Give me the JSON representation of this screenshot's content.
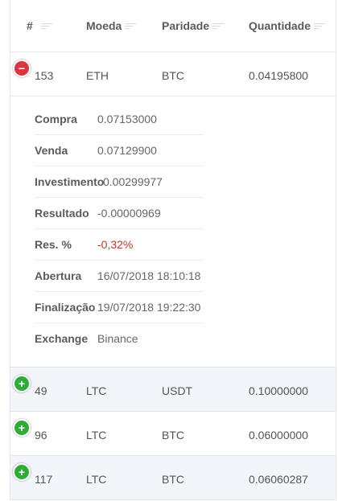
{
  "columns": {
    "id": "#",
    "coin": "Moeda",
    "pair": "Paridade",
    "qty": "Quantidade"
  },
  "expanded_row": {
    "id": "153",
    "coin": "ETH",
    "pair": "BTC",
    "qty": "0.04195800",
    "toggle_icon": "minus-circle-icon",
    "details": [
      {
        "label": "Compra",
        "value": "0.07153000"
      },
      {
        "label": "Venda",
        "value": "0.07129900"
      },
      {
        "label": "Investimento",
        "value": "0.00299977"
      },
      {
        "label": "Resultado",
        "value": "-0.00000969"
      },
      {
        "label": "Res. %",
        "value": "-0,32%",
        "color": "#c0392b"
      },
      {
        "label": "Abertura",
        "value": "16/07/2018 18:10:18"
      },
      {
        "label": "Finalização",
        "value": "19/07/2018 19:22:30"
      },
      {
        "label": "Exchange",
        "value": "Binance"
      }
    ]
  },
  "rows": [
    {
      "id": "49",
      "coin": "LTC",
      "pair": "USDT",
      "qty": "0.10000000",
      "toggle_icon": "plus-circle-icon"
    },
    {
      "id": "96",
      "coin": "LTC",
      "pair": "BTC",
      "qty": "0.06000000",
      "toggle_icon": "plus-circle-icon"
    },
    {
      "id": "117",
      "coin": "LTC",
      "pair": "BTC",
      "qty": "0.06060287",
      "toggle_icon": "plus-circle-icon"
    }
  ],
  "colors": {
    "minus": "#d9363e",
    "plus": "#2fab3a",
    "stripe": "#f2f6fa",
    "negative": "#c0392b"
  }
}
